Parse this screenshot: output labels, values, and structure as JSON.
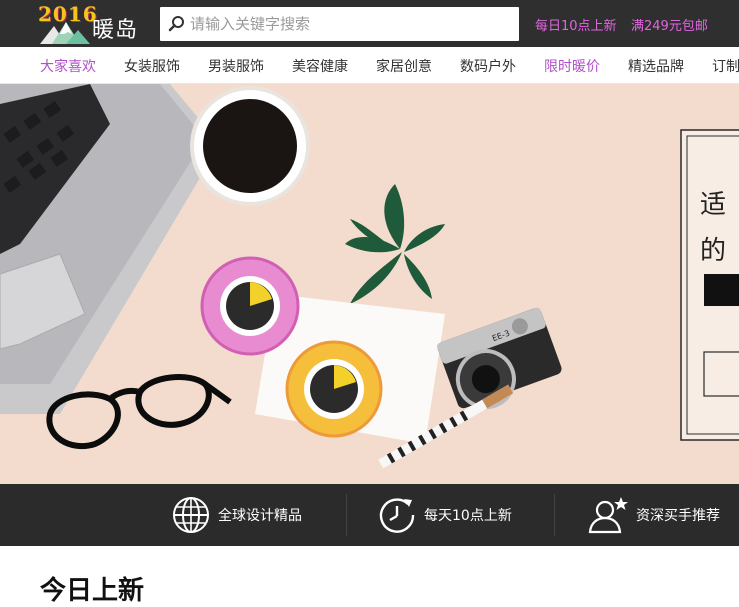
{
  "logo": {
    "year": "2016",
    "name": "暖岛"
  },
  "search": {
    "placeholder": "请输入关键字搜索",
    "value": ""
  },
  "promos": [
    "每日10点上新",
    "满249元包邮"
  ],
  "nav": [
    {
      "label": "大家喜欢",
      "highlight": true
    },
    {
      "label": "女装服饰",
      "highlight": false
    },
    {
      "label": "男装服饰",
      "highlight": false
    },
    {
      "label": "美容健康",
      "highlight": false
    },
    {
      "label": "家居创意",
      "highlight": false
    },
    {
      "label": "数码户外",
      "highlight": false
    },
    {
      "label": "限时暖价",
      "highlight": true
    },
    {
      "label": "精选品牌",
      "highlight": false
    },
    {
      "label": "订制",
      "highlight": false
    }
  ],
  "hero": {
    "text_line1": "适",
    "text_line2": "的"
  },
  "features": [
    {
      "label": "全球设计精品",
      "icon": "globe-icon"
    },
    {
      "label": "每天10点上新",
      "icon": "clock-refresh-icon"
    },
    {
      "label": "资深买手推荐",
      "icon": "buyer-star-icon"
    }
  ],
  "section": {
    "title": "今日上新"
  },
  "colors": {
    "topbar": "#2f2f2f",
    "accent": "#b04fc8",
    "promo": "#e066e0",
    "hero_bg": "#f3dccd",
    "features_bg": "#2b2b2b"
  }
}
